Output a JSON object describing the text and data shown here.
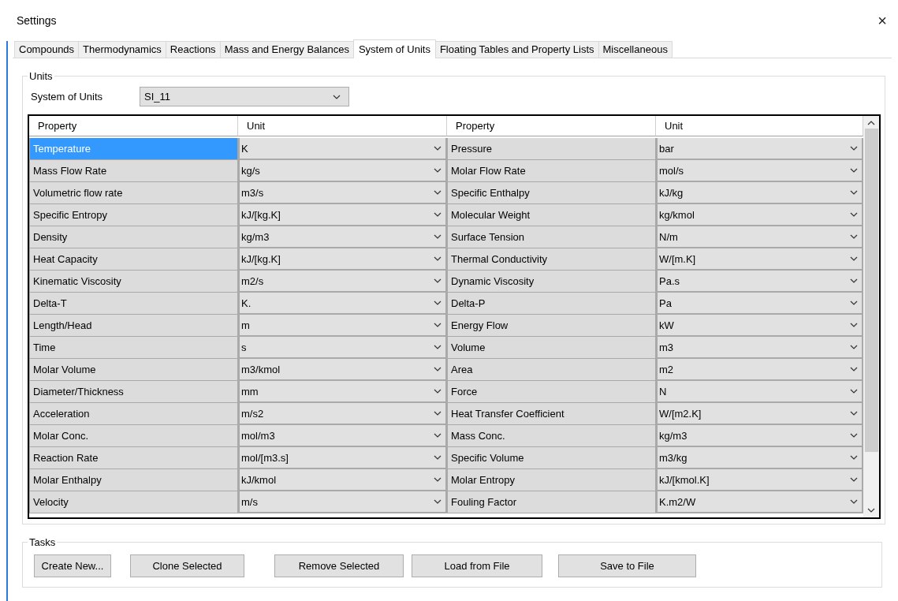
{
  "window": {
    "title": "Settings",
    "close": "×"
  },
  "tabs": [
    {
      "label": "Compounds",
      "selected": false
    },
    {
      "label": "Thermodynamics",
      "selected": false
    },
    {
      "label": "Reactions",
      "selected": false
    },
    {
      "label": "Mass and Energy Balances",
      "selected": false
    },
    {
      "label": "System of Units",
      "selected": true
    },
    {
      "label": "Floating Tables and Property Lists",
      "selected": false
    },
    {
      "label": "Miscellaneous",
      "selected": false
    }
  ],
  "units_group": {
    "title": "Units",
    "system_label": "System of Units",
    "system_value": "SI_11"
  },
  "table": {
    "columns": [
      "Property",
      "Unit",
      "Property",
      "Unit"
    ],
    "rows": [
      {
        "left": {
          "property": "Temperature",
          "unit": "K",
          "selected": true
        },
        "right": {
          "property": "Pressure",
          "unit": "bar",
          "selected": false
        }
      },
      {
        "left": {
          "property": "Mass Flow Rate",
          "unit": "kg/s",
          "selected": false
        },
        "right": {
          "property": "Molar Flow Rate",
          "unit": "mol/s",
          "selected": false
        }
      },
      {
        "left": {
          "property": "Volumetric flow rate",
          "unit": "m3/s",
          "selected": false
        },
        "right": {
          "property": "Specific Enthalpy",
          "unit": "kJ/kg",
          "selected": false
        }
      },
      {
        "left": {
          "property": "Specific Entropy",
          "unit": "kJ/[kg.K]",
          "selected": false
        },
        "right": {
          "property": "Molecular Weight",
          "unit": "kg/kmol",
          "selected": false
        }
      },
      {
        "left": {
          "property": "Density",
          "unit": "kg/m3",
          "selected": false
        },
        "right": {
          "property": "Surface Tension",
          "unit": "N/m",
          "selected": false
        }
      },
      {
        "left": {
          "property": "Heat Capacity",
          "unit": "kJ/[kg.K]",
          "selected": false
        },
        "right": {
          "property": "Thermal Conductivity",
          "unit": "W/[m.K]",
          "selected": false
        }
      },
      {
        "left": {
          "property": "Kinematic Viscosity",
          "unit": "m2/s",
          "selected": false
        },
        "right": {
          "property": "Dynamic Viscosity",
          "unit": "Pa.s",
          "selected": false
        }
      },
      {
        "left": {
          "property": "Delta-T",
          "unit": "K.",
          "selected": false
        },
        "right": {
          "property": "Delta-P",
          "unit": "Pa",
          "selected": false
        }
      },
      {
        "left": {
          "property": "Length/Head",
          "unit": "m",
          "selected": false
        },
        "right": {
          "property": "Energy Flow",
          "unit": "kW",
          "selected": false
        }
      },
      {
        "left": {
          "property": "Time",
          "unit": "s",
          "selected": false
        },
        "right": {
          "property": "Volume",
          "unit": "m3",
          "selected": false
        }
      },
      {
        "left": {
          "property": "Molar Volume",
          "unit": "m3/kmol",
          "selected": false
        },
        "right": {
          "property": "Area",
          "unit": "m2",
          "selected": false
        }
      },
      {
        "left": {
          "property": "Diameter/Thickness",
          "unit": "mm",
          "selected": false
        },
        "right": {
          "property": "Force",
          "unit": "N",
          "selected": false
        }
      },
      {
        "left": {
          "property": "Acceleration",
          "unit": "m/s2",
          "selected": false
        },
        "right": {
          "property": "Heat Transfer Coefficient",
          "unit": "W/[m2.K]",
          "selected": false
        }
      },
      {
        "left": {
          "property": "Molar Conc.",
          "unit": "mol/m3",
          "selected": false
        },
        "right": {
          "property": "Mass Conc.",
          "unit": "kg/m3",
          "selected": false
        }
      },
      {
        "left": {
          "property": "Reaction Rate",
          "unit": "mol/[m3.s]",
          "selected": false
        },
        "right": {
          "property": "Specific Volume",
          "unit": "m3/kg",
          "selected": false
        }
      },
      {
        "left": {
          "property": "Molar Enthalpy",
          "unit": "kJ/kmol",
          "selected": false
        },
        "right": {
          "property": "Molar Entropy",
          "unit": "kJ/[kmol.K]",
          "selected": false
        }
      },
      {
        "left": {
          "property": "Velocity",
          "unit": "m/s",
          "selected": false
        },
        "right": {
          "property": "Fouling Factor",
          "unit": "K.m2/W",
          "selected": false
        }
      }
    ]
  },
  "tasks_group": {
    "title": "Tasks",
    "buttons": [
      "Create New...",
      "Clone Selected",
      "Remove Selected",
      "Load from File",
      "Save to File"
    ]
  }
}
